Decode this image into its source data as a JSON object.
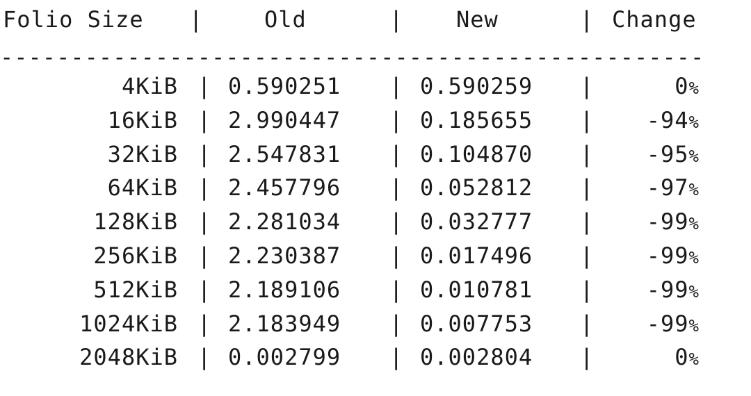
{
  "header": {
    "folio_size": "Folio Size",
    "old": "Old",
    "new": "New",
    "change": "Change",
    "separator": "|"
  },
  "divider": "--------------------------------------------------",
  "rows": [
    {
      "folio_size": "4KiB",
      "old": "0.590251",
      "new": "0.590259",
      "change": "0",
      "unit": "%"
    },
    {
      "folio_size": "16KiB",
      "old": "2.990447",
      "new": "0.185655",
      "change": "-94",
      "unit": "%"
    },
    {
      "folio_size": "32KiB",
      "old": "2.547831",
      "new": "0.104870",
      "change": "-95",
      "unit": "%"
    },
    {
      "folio_size": "64KiB",
      "old": "2.457796",
      "new": "0.052812",
      "change": "-97",
      "unit": "%"
    },
    {
      "folio_size": "128KiB",
      "old": "2.281034",
      "new": "0.032777",
      "change": "-99",
      "unit": "%"
    },
    {
      "folio_size": "256KiB",
      "old": "2.230387",
      "new": "0.017496",
      "change": "-99",
      "unit": "%"
    },
    {
      "folio_size": "512KiB",
      "old": "2.189106",
      "new": "0.010781",
      "change": "-99",
      "unit": "%"
    },
    {
      "folio_size": "1024KiB",
      "old": "2.183949",
      "new": "0.007753",
      "change": "-99",
      "unit": "%"
    },
    {
      "folio_size": "2048KiB",
      "old": "0.002799",
      "new": "0.002804",
      "change": "0",
      "unit": "%"
    }
  ]
}
